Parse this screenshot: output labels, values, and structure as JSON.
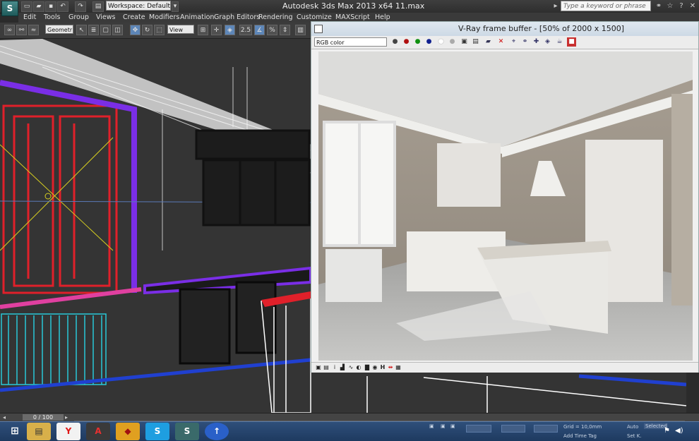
{
  "window": {
    "app_logo": "S",
    "title": "Autodesk 3ds Max  2013 x64     11.max",
    "workspace": "Workspace: Default",
    "search_placeholder": "Type a keyword or phrase"
  },
  "menu": [
    "Edit",
    "Tools",
    "Group",
    "Views",
    "Create",
    "Modifiers",
    "Animation",
    "Graph Editors",
    "Rendering",
    "Customize",
    "MAXScript",
    "Help"
  ],
  "toolbar": {
    "selection_filter": "Geometr",
    "reference_coord": "View",
    "snap_label": "2.5"
  },
  "vray": {
    "title": "V-Ray frame buffer - [50% of 2000 x 1500]",
    "channel": "RGB color"
  },
  "timeline": {
    "frame": "0 / 100"
  },
  "status": {
    "grid": "Grid = 10,0mm",
    "add_time_tag": "Add Time Tag",
    "auto": "Auto",
    "set_k": "Set K.",
    "selected": "Selected"
  },
  "taskbar": {
    "apps": [
      "windows-start",
      "file-explorer",
      "yandex-browser",
      "autocad",
      "photo-app",
      "skype",
      "3ds-max",
      "uploader"
    ]
  },
  "colors": {
    "wire_red": "#e0202a",
    "wire_purple": "#7a2ee6",
    "wire_cyan": "#28c8d8",
    "wire_white": "#ffffff",
    "wire_yellow": "#d8d020"
  }
}
